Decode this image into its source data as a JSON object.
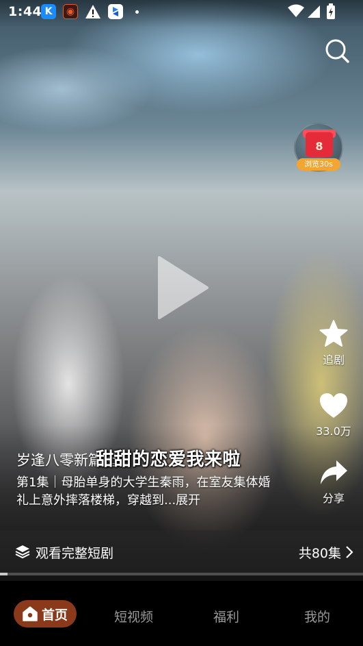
{
  "status_bar": {
    "time": "1:44",
    "app_icons": [
      "k-app-icon",
      "circle-app-icon",
      "warning-icon",
      "blue-app-icon"
    ],
    "indicators": [
      "wifi-icon",
      "signal-icon",
      "battery-icon"
    ]
  },
  "reward": {
    "count": "8",
    "label": "浏览30s"
  },
  "sidebar": {
    "follow_label": "追剧",
    "like_count": "33.0万",
    "share_label": "分享"
  },
  "video": {
    "subtitle": "甜甜的恋爱我来啦",
    "drama_title": "岁逢八零新篇起",
    "episode_desc": "第1集｜母胎单身的大学生秦雨，在室友集体婚礼上意外摔落楼梯，穿越到...展开",
    "progress": 0.02
  },
  "watch_bar": {
    "label": "观看完整短剧",
    "episode_count": "共80集"
  },
  "bottom_nav": {
    "items": [
      {
        "label": "首页",
        "active": true
      },
      {
        "label": "短视频",
        "active": false
      },
      {
        "label": "福利",
        "active": false
      },
      {
        "label": "我的",
        "active": false
      }
    ]
  },
  "colors": {
    "home_pill": "#8a3a1a",
    "reward_red": "#e52b3a",
    "reward_orange": "#f2a531",
    "nav_inactive": "#9a9a9a"
  }
}
